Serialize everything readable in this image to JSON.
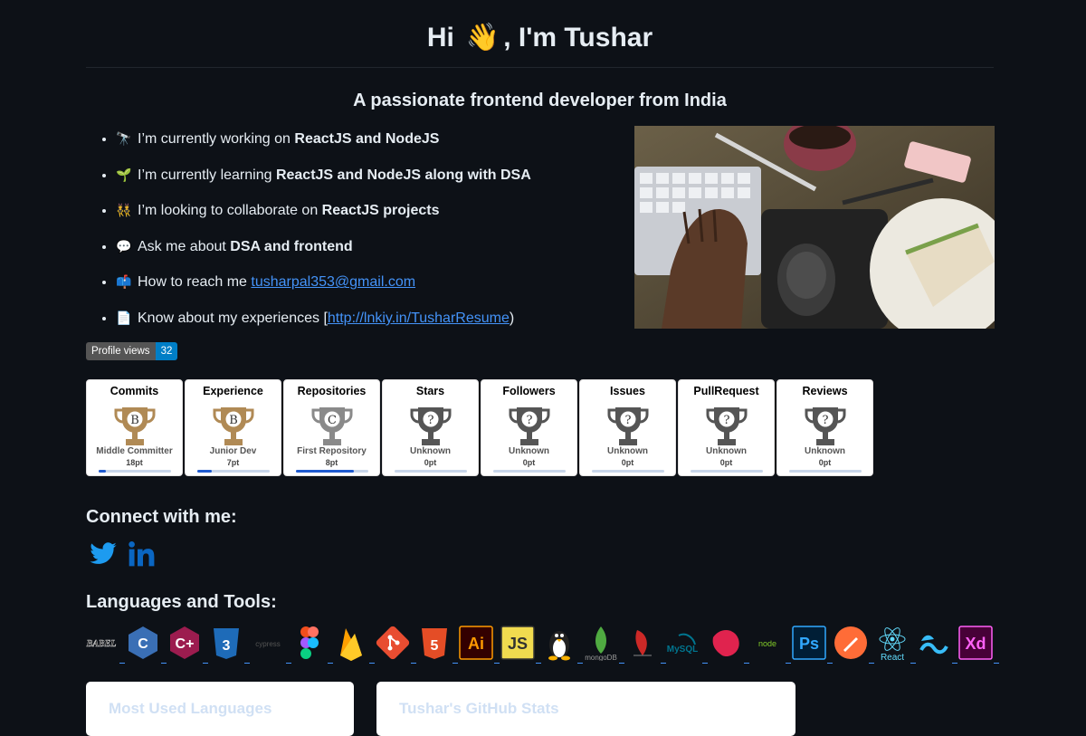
{
  "header": {
    "title_pre": "Hi",
    "title_wave": "👋",
    "title_post": ", I'm Tushar",
    "subtitle": "A passionate frontend developer from India"
  },
  "about": [
    {
      "emoji": "🔭",
      "pre": "I’m currently working on ",
      "bold": "ReactJS and NodeJS",
      "post": ""
    },
    {
      "emoji": "🌱",
      "pre": "I’m currently learning ",
      "bold": "ReactJS and NodeJS along with DSA",
      "post": ""
    },
    {
      "emoji": "👯",
      "pre": "I’m looking to collaborate on ",
      "bold": "ReactJS projects",
      "post": ""
    },
    {
      "emoji": "💬",
      "pre": "Ask me about ",
      "bold": "DSA and frontend",
      "post": ""
    },
    {
      "emoji": "📫",
      "pre": "How to reach me ",
      "link": "tusharpal353@gmail.com"
    },
    {
      "emoji": "📄",
      "pre": "Know about my experiences [",
      "link": "http://lnkiy.in/TusharResume",
      "post": ")"
    }
  ],
  "badge": {
    "label": "Profile views",
    "value": "32"
  },
  "trophies": [
    {
      "title": "Commits",
      "rank_letter": "B",
      "rank": "Middle Committer",
      "points": "18pt",
      "progress": 0.1,
      "color": "#b08a55"
    },
    {
      "title": "Experience",
      "rank_letter": "B",
      "rank": "Junior Dev",
      "points": "7pt",
      "progress": 0.2,
      "color": "#b08a55"
    },
    {
      "title": "Repositories",
      "rank_letter": "C",
      "rank": "First Repository",
      "points": "8pt",
      "progress": 0.8,
      "color": "#8a8a8a"
    },
    {
      "title": "Stars",
      "rank_letter": "?",
      "rank": "Unknown",
      "points": "0pt",
      "progress": 0,
      "color": "#555555"
    },
    {
      "title": "Followers",
      "rank_letter": "?",
      "rank": "Unknown",
      "points": "0pt",
      "progress": 0,
      "color": "#555555"
    },
    {
      "title": "Issues",
      "rank_letter": "?",
      "rank": "Unknown",
      "points": "0pt",
      "progress": 0,
      "color": "#555555"
    },
    {
      "title": "PullRequest",
      "rank_letter": "?",
      "rank": "Unknown",
      "points": "0pt",
      "progress": 0,
      "color": "#555555"
    },
    {
      "title": "Reviews",
      "rank_letter": "?",
      "rank": "Unknown",
      "points": "0pt",
      "progress": 0,
      "color": "#555555"
    }
  ],
  "connect": {
    "heading": "Connect with me:",
    "links": [
      {
        "icon": "twitter-icon",
        "color": "#1d9bf0"
      },
      {
        "icon": "linkedin-icon",
        "color": "#0a66c2"
      }
    ]
  },
  "tools": {
    "heading": "Languages and Tools:",
    "items": [
      {
        "name": "babel",
        "label": "BABEL"
      },
      {
        "name": "c",
        "label": "C"
      },
      {
        "name": "cplusplus",
        "label": "C+"
      },
      {
        "name": "css3",
        "label": "3"
      },
      {
        "name": "cypress",
        "label": "cypress"
      },
      {
        "name": "figma",
        "label": ""
      },
      {
        "name": "firebase",
        "label": ""
      },
      {
        "name": "git",
        "label": ""
      },
      {
        "name": "html5",
        "label": "5"
      },
      {
        "name": "illustrator",
        "label": "Ai"
      },
      {
        "name": "javascript",
        "label": "JS"
      },
      {
        "name": "linux",
        "label": ""
      },
      {
        "name": "mongodb",
        "label": "mongoDB"
      },
      {
        "name": "mssql",
        "label": ""
      },
      {
        "name": "mysql",
        "label": "MySQL"
      },
      {
        "name": "nestjs",
        "label": ""
      },
      {
        "name": "nodejs",
        "label": "node"
      },
      {
        "name": "photoshop",
        "label": "Ps"
      },
      {
        "name": "postman",
        "label": ""
      },
      {
        "name": "react",
        "label": "React"
      },
      {
        "name": "tailwind",
        "label": ""
      },
      {
        "name": "xd",
        "label": "Xd"
      }
    ]
  },
  "cards": [
    {
      "title": "Most Used Languages"
    },
    {
      "title": "Tushar's GitHub Stats"
    }
  ]
}
